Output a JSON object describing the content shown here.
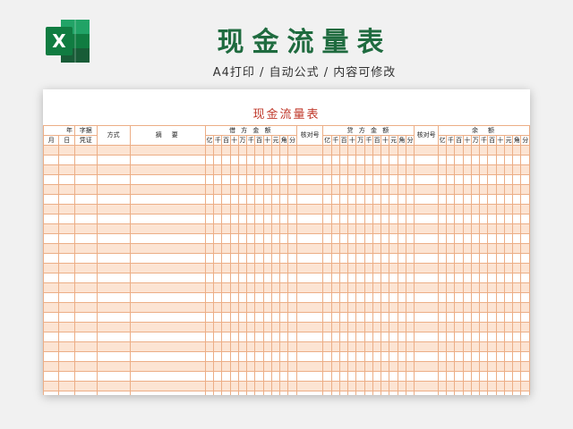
{
  "banner": {
    "title": "现金流量表",
    "subtitle": "A4打印 / 自动公式 / 内容可修改",
    "icon": "excel-icon",
    "icon_letter": "X"
  },
  "sheet": {
    "title": "现金流量表",
    "headers": {
      "year": "年",
      "voucher_no": "字据",
      "month": "月",
      "day": "日",
      "voucher": "凭证",
      "method": "方式",
      "summary": "摘　要",
      "debit_amount": "借 方 金 额",
      "check_no": "核对号",
      "credit_amount": "贷 方 金 额",
      "balance": "余　额"
    },
    "digit_labels": [
      "亿",
      "千",
      "百",
      "十",
      "万",
      "千",
      "百",
      "十",
      "元",
      "角",
      "分"
    ],
    "row_count": 27,
    "colors": {
      "border": "#ecae86",
      "stripe": "#fce4d3",
      "title": "#c0392b",
      "banner_title": "#1f6b3f"
    }
  }
}
